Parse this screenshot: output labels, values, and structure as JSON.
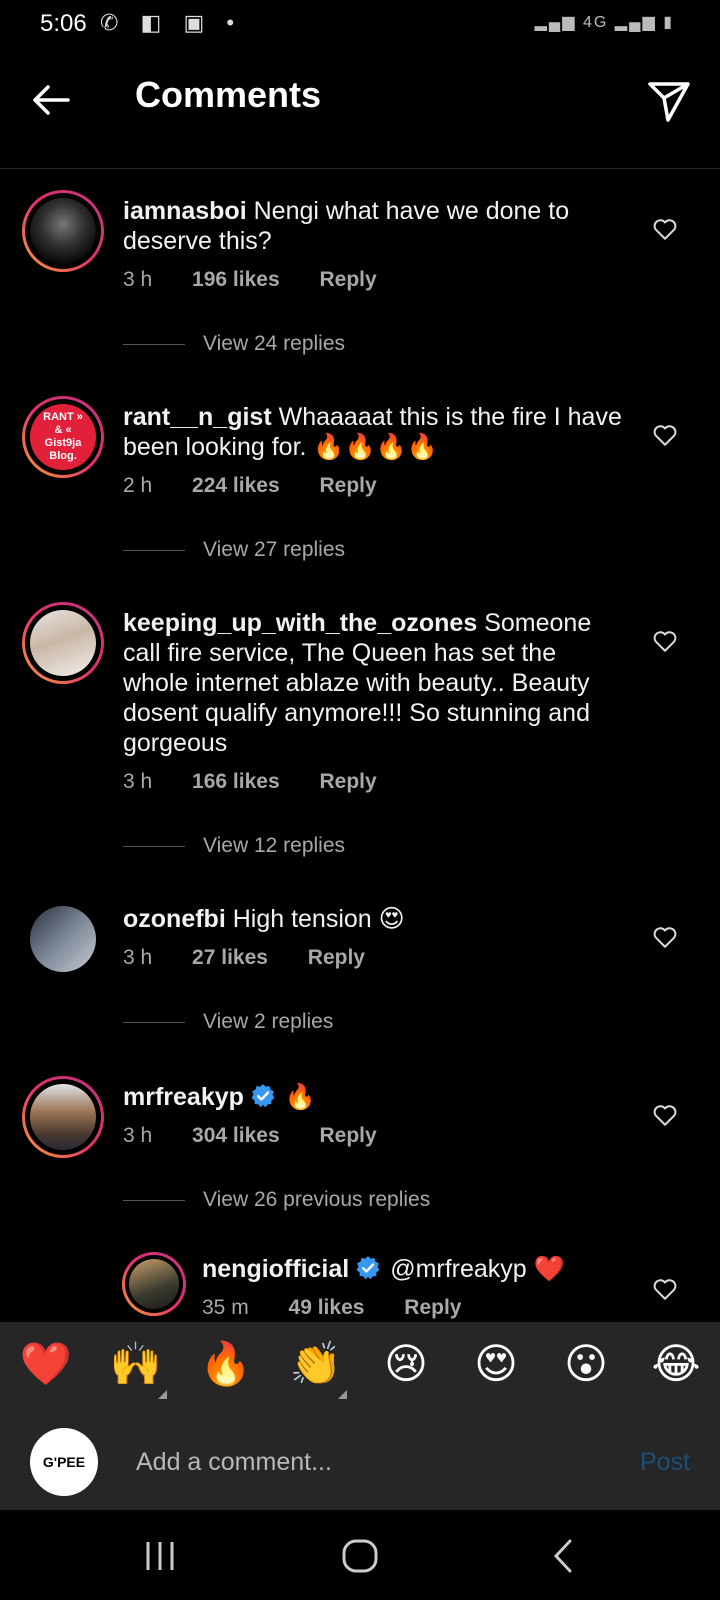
{
  "status": {
    "time": "5:06",
    "network": "4G"
  },
  "header": {
    "title": "Comments"
  },
  "comments": [
    {
      "user": "iamnasboi",
      "text": "Nengi what have we done to deserve this?",
      "time": "3 h",
      "likes": "196 likes",
      "reply": "Reply",
      "replies": "View 24 replies"
    },
    {
      "user": "rant__n_gist",
      "text": "Whaaaaat this is the fire I have been looking for. 🔥🔥🔥🔥",
      "time": "2 h",
      "likes": "224 likes",
      "reply": "Reply",
      "replies": "View 27 replies",
      "avatar_text": "RANT » & « Gist9ja Blog."
    },
    {
      "user": "keeping_up_with_the_ozones",
      "text": "Someone call fire service, The Queen has set the whole internet ablaze with beauty.. Beauty dosent qualify anymore!!! So stunning and gorgeous",
      "time": "3 h",
      "likes": "166 likes",
      "reply": "Reply",
      "replies": "View 12 replies"
    },
    {
      "user": "ozonefbi",
      "text": "High tension 😍",
      "time": "3 h",
      "likes": "27 likes",
      "reply": "Reply",
      "replies": "View 2 replies"
    },
    {
      "user": "mrfreakyp",
      "text": "🔥",
      "time": "3 h",
      "likes": "304 likes",
      "reply": "Reply",
      "replies": "View 26 previous replies"
    }
  ],
  "reply": {
    "user": "nengiofficial",
    "text": "@mrfreakyp ❤️",
    "time": "35 m",
    "likes": "49 likes",
    "reply": "Reply"
  },
  "emojis": [
    "❤️",
    "🙌",
    "🔥",
    "👏",
    "😢",
    "😍",
    "😮",
    "😂"
  ],
  "input": {
    "placeholder": "Add a comment...",
    "post": "Post",
    "avatar_text": "G'PEE"
  },
  "colors": {
    "background": "#000000",
    "secondary_text": "#a8a8a8",
    "post_disabled": "#1c4f78",
    "verified": "#3897f0"
  }
}
